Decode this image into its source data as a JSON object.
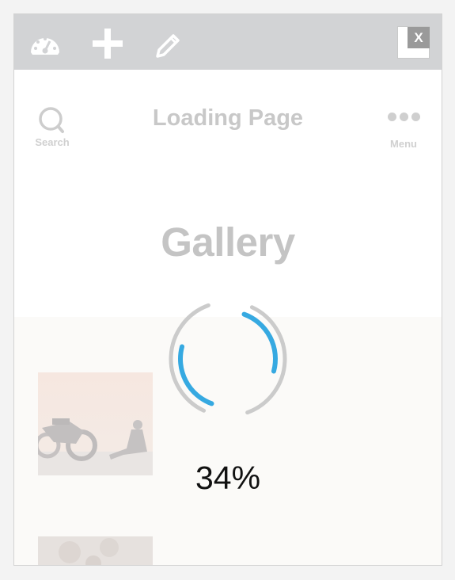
{
  "toolbar": {
    "icons": [
      "dashboard-gauge-icon",
      "plus-icon",
      "pencil-icon"
    ],
    "close_label": "X"
  },
  "header": {
    "search_label": "Search",
    "title": "Loading Page",
    "menu_label": "Menu"
  },
  "content": {
    "gallery_title": "Gallery"
  },
  "loader": {
    "percent_text": "34%",
    "progress": 0.34,
    "accent_color": "#36a9e1",
    "track_color": "#cbcbcb"
  },
  "colors": {
    "toolbar_bg": "#d2d3d5",
    "faded_text": "#c8c8c8"
  }
}
